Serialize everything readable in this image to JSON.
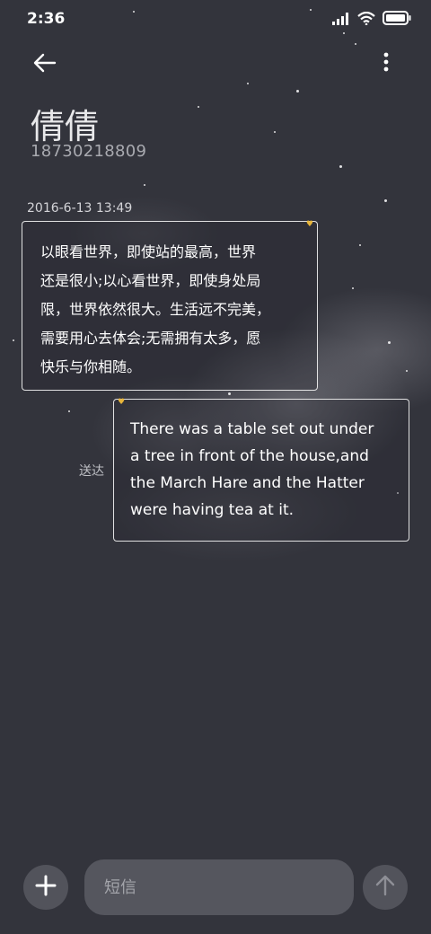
{
  "status_bar": {
    "time": "2:36",
    "icons": [
      "signal-icon",
      "wifi-icon",
      "battery-icon"
    ]
  },
  "header": {
    "back_icon": "arrow-left-icon",
    "more_icon": "more-vertical-icon",
    "contact_name": "倩倩",
    "contact_number": "18730218809"
  },
  "conversation": {
    "timestamp": "2016-6-13 13:49",
    "messages": [
      {
        "direction": "incoming",
        "text": "以眼看世界，即使站的最高，世界\n还是很小;以心看世界，即使身处局\n限，世界依然很大。生活远不完美，\n需要用心去体会;无需拥有太多，愿\n快乐与你相随。"
      },
      {
        "direction": "outgoing",
        "text": "There was a table set out under\na tree in front of the house,and\nthe March Hare and the Hatter\nwere having tea at it.",
        "status": "送达"
      }
    ]
  },
  "composer": {
    "add_icon": "plus-icon",
    "placeholder": "短信",
    "value": "",
    "send_icon": "arrow-up-icon"
  },
  "colors": {
    "background": "#33343c",
    "bubble_border": "#ffffff",
    "accent_heart": "#e8b53a",
    "input_background": "#55565e"
  }
}
